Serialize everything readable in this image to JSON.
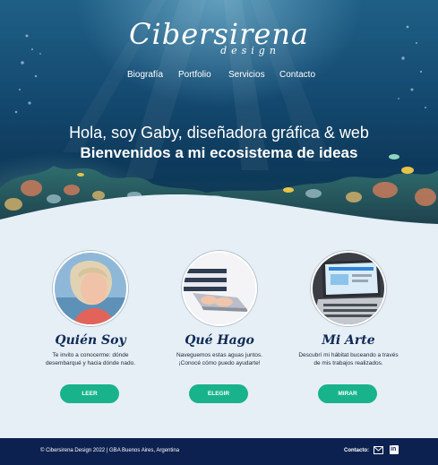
{
  "logo": {
    "main": "Cibersirena",
    "sub": "design"
  },
  "nav": [
    {
      "label": "Biografía"
    },
    {
      "label": "Portfolio"
    },
    {
      "label": "Servicios"
    },
    {
      "label": "Contacto"
    }
  ],
  "hero": {
    "headline": "Hola, soy Gaby, diseñadora gráfica & web",
    "subheadline": "Bienvenidos a mi ecosistema de ideas"
  },
  "cards": [
    {
      "title": "Quién Soy",
      "text": "Te invito a conocerme: dónde desembarqué y hacia dónde nado.",
      "button": "LEER"
    },
    {
      "title": "Qué Hago",
      "text": "Naveguemos estas aguas juntos. ¡Conocé cómo puedo ayudarte!",
      "button": "ELEGIR"
    },
    {
      "title": "Mi Arte",
      "text": "Descubrí mi hábitat buceando a través de mis trabajos realizados.",
      "button": "MIRAR"
    }
  ],
  "footer": {
    "copyright": "© Cibersirena Design 2022 | GBA Buenos Aires, Argentina",
    "contact_label": "Contacto:",
    "linkedin_glyph": "in"
  },
  "colors": {
    "accent_button": "#19b38b",
    "footer_bg": "#0c2150",
    "title_color": "#0f2a55",
    "page_bg": "#e6eef6"
  },
  "icons": [
    "mail-icon",
    "linkedin-icon"
  ]
}
